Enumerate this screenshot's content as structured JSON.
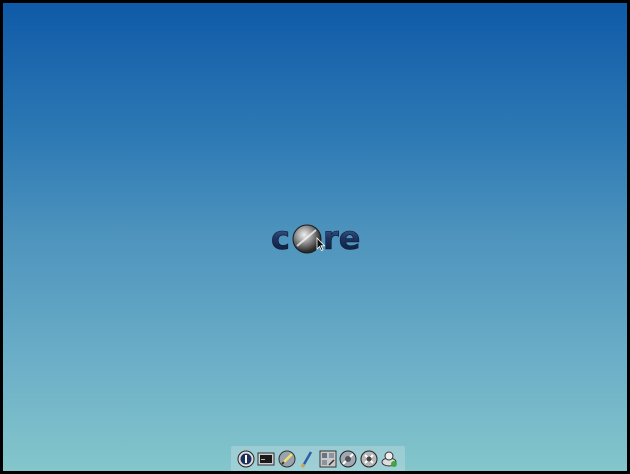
{
  "desktop": {
    "gradient_top": "#0f5aa7",
    "gradient_bottom": "#84c6cb",
    "logo_text_left": "c",
    "logo_text_right": "re"
  },
  "dock": {
    "items": [
      {
        "name": "power-icon",
        "label": ""
      },
      {
        "name": "terminal-icon",
        "label": ""
      },
      {
        "name": "editor-icon",
        "label": ""
      },
      {
        "name": "brush-icon",
        "label": ""
      },
      {
        "name": "control-panel-icon",
        "label": ""
      },
      {
        "name": "apps-icon",
        "label": ""
      },
      {
        "name": "settings-icon",
        "label": ""
      },
      {
        "name": "mount-icon",
        "label": ""
      }
    ]
  }
}
